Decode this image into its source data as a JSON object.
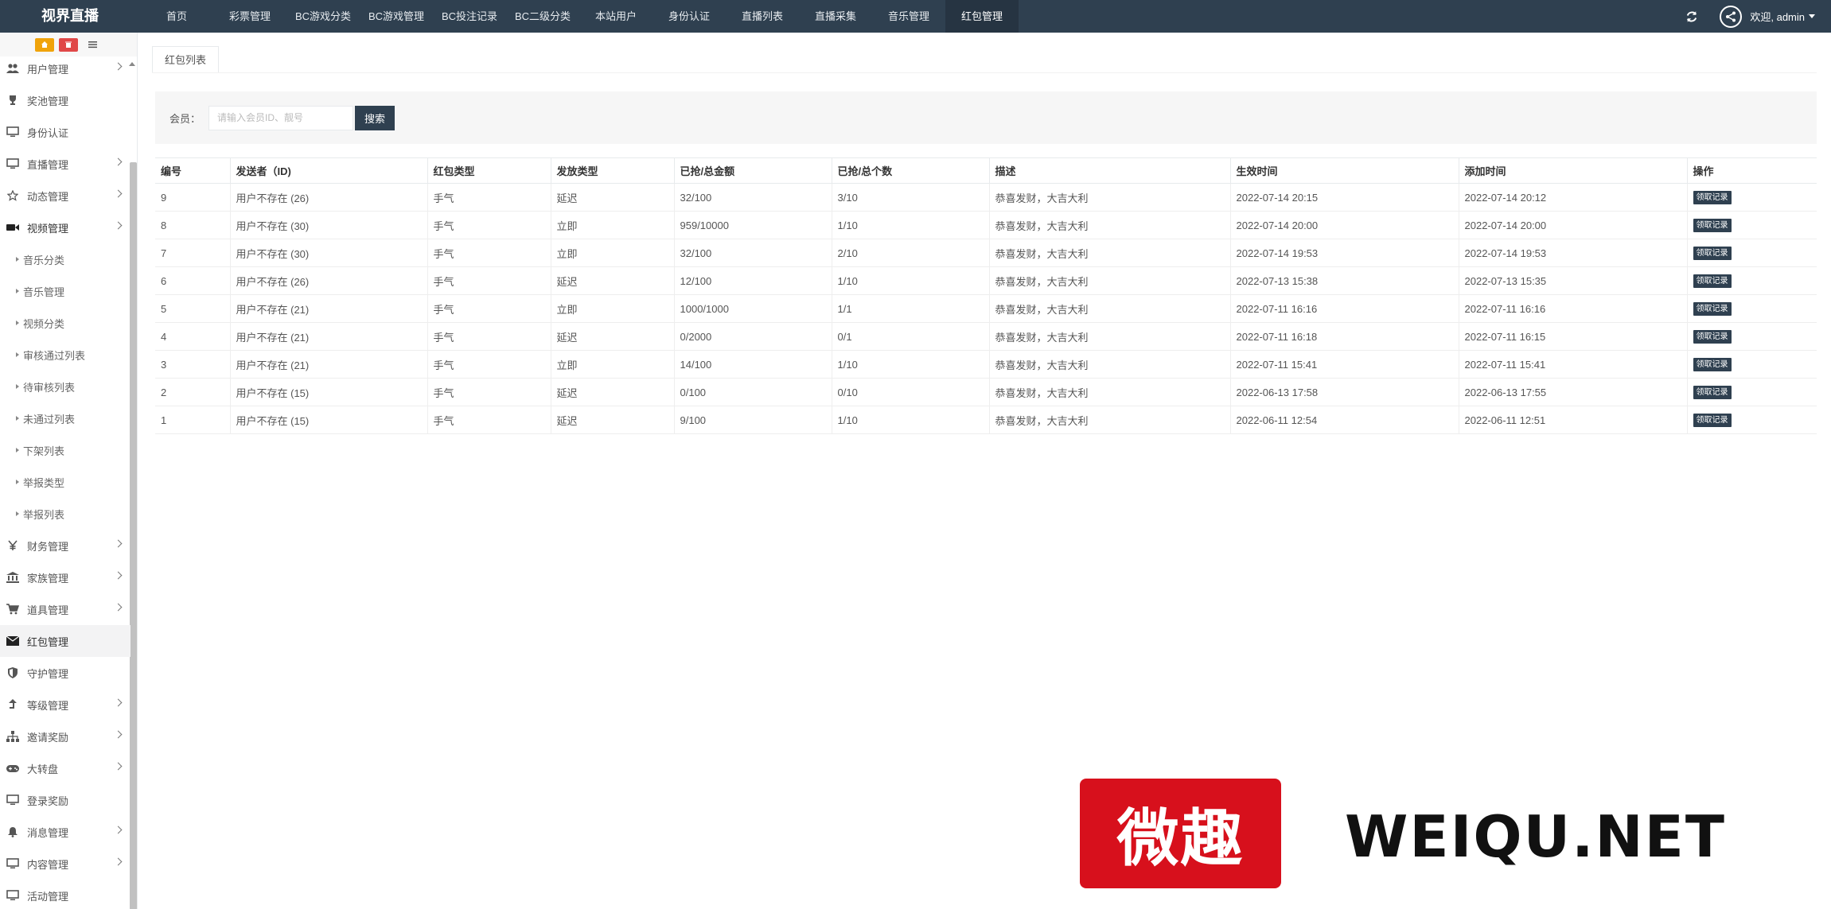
{
  "brand": "视界直播",
  "nav": [
    "首页",
    "彩票管理",
    "BC游戏分类",
    "BC游戏管理",
    "BC投注记录",
    "BC二级分类",
    "本站用户",
    "身份认证",
    "直播列表",
    "直播采集",
    "音乐管理",
    "红包管理"
  ],
  "user": {
    "greeting": "欢迎, admin"
  },
  "sidebar": {
    "items": [
      {
        "label": "用户管理",
        "icon": "users-icon",
        "arrow": true
      },
      {
        "label": "奖池管理",
        "icon": "trophy-icon",
        "arrow": false
      },
      {
        "label": "身份认证",
        "icon": "monitor-icon",
        "arrow": false
      },
      {
        "label": "直播管理",
        "icon": "monitor-icon",
        "arrow": true
      },
      {
        "label": "动态管理",
        "icon": "star-icon",
        "arrow": true
      },
      {
        "label": "视频管理",
        "icon": "video-camera-icon",
        "arrow": true,
        "open": true
      },
      {
        "label": "音乐分类",
        "sub": true
      },
      {
        "label": "音乐管理",
        "sub": true
      },
      {
        "label": "视频分类",
        "sub": true
      },
      {
        "label": "审核通过列表",
        "sub": true
      },
      {
        "label": "待审核列表",
        "sub": true
      },
      {
        "label": "未通过列表",
        "sub": true
      },
      {
        "label": "下架列表",
        "sub": true
      },
      {
        "label": "举报类型",
        "sub": true
      },
      {
        "label": "举报列表",
        "sub": true
      },
      {
        "label": "财务管理",
        "icon": "yen-icon",
        "arrow": true
      },
      {
        "label": "家族管理",
        "icon": "bank-icon",
        "arrow": true
      },
      {
        "label": "道具管理",
        "icon": "cart-icon",
        "arrow": true
      },
      {
        "label": "红包管理",
        "icon": "envelope-icon",
        "arrow": false,
        "active": true
      },
      {
        "label": "守护管理",
        "icon": "shield-icon",
        "arrow": false
      },
      {
        "label": "等级管理",
        "icon": "level-up-icon",
        "arrow": true
      },
      {
        "label": "邀请奖励",
        "icon": "sitemap-icon",
        "arrow": true
      },
      {
        "label": "大转盘",
        "icon": "gamepad-icon",
        "arrow": true
      },
      {
        "label": "登录奖励",
        "icon": "monitor-icon",
        "arrow": false
      },
      {
        "label": "消息管理",
        "icon": "bell-icon",
        "arrow": true
      },
      {
        "label": "内容管理",
        "icon": "monitor-icon",
        "arrow": true
      },
      {
        "label": "活动管理",
        "icon": "monitor-icon",
        "arrow": false
      }
    ]
  },
  "tab": "红包列表",
  "search": {
    "label": "会员：",
    "placeholder": "请输入会员ID、靓号",
    "button": "搜索"
  },
  "table": {
    "headers": [
      "编号",
      "发送者（ID)",
      "红包类型",
      "发放类型",
      "已抢/总金额",
      "已抢/总个数",
      "描述",
      "生效时间",
      "添加时间",
      "操作"
    ],
    "rows": [
      [
        "9",
        "用户不存在 (26)",
        "手气",
        "延迟",
        "32/100",
        "3/10",
        "恭喜发财，大吉大利",
        "2022-07-14 20:15",
        "2022-07-14 20:12",
        "领取记录"
      ],
      [
        "8",
        "用户不存在 (30)",
        "手气",
        "立即",
        "959/10000",
        "1/10",
        "恭喜发财，大吉大利",
        "2022-07-14 20:00",
        "2022-07-14 20:00",
        "领取记录"
      ],
      [
        "7",
        "用户不存在 (30)",
        "手气",
        "立即",
        "32/100",
        "2/10",
        "恭喜发财，大吉大利",
        "2022-07-14 19:53",
        "2022-07-14 19:53",
        "领取记录"
      ],
      [
        "6",
        "用户不存在 (26)",
        "手气",
        "延迟",
        "12/100",
        "1/10",
        "恭喜发财，大吉大利",
        "2022-07-13 15:38",
        "2022-07-13 15:35",
        "领取记录"
      ],
      [
        "5",
        "用户不存在 (21)",
        "手气",
        "立即",
        "1000/1000",
        "1/1",
        "恭喜发财，大吉大利",
        "2022-07-11 16:16",
        "2022-07-11 16:16",
        "领取记录"
      ],
      [
        "4",
        "用户不存在 (21)",
        "手气",
        "延迟",
        "0/2000",
        "0/1",
        "恭喜发财，大吉大利",
        "2022-07-11 16:18",
        "2022-07-11 16:15",
        "领取记录"
      ],
      [
        "3",
        "用户不存在 (21)",
        "手气",
        "立即",
        "14/100",
        "1/10",
        "恭喜发财，大吉大利",
        "2022-07-11 15:41",
        "2022-07-11 15:41",
        "领取记录"
      ],
      [
        "2",
        "用户不存在 (15)",
        "手气",
        "延迟",
        "0/100",
        "0/10",
        "恭喜发财，大吉大利",
        "2022-06-13 17:58",
        "2022-06-13 17:55",
        "领取记录"
      ],
      [
        "1",
        "用户不存在 (15)",
        "手气",
        "延迟",
        "9/100",
        "1/10",
        "恭喜发财，大吉大利",
        "2022-06-11 12:54",
        "2022-06-11 12:51",
        "领取记录"
      ]
    ]
  },
  "watermark": {
    "seal": "微趣",
    "text": "WEIQU.NET"
  },
  "colors": {
    "nav_bg": "#2f4050",
    "seal_red": "#d7101c"
  }
}
